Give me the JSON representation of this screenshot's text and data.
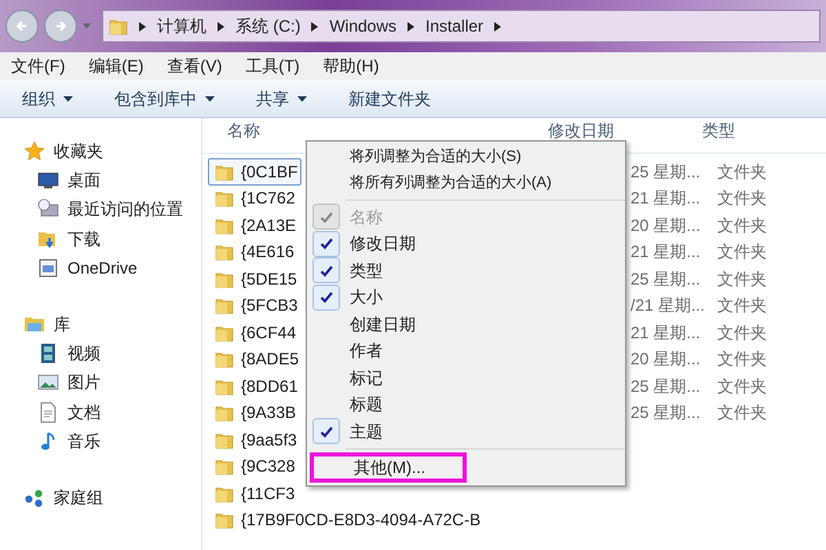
{
  "address": {
    "crumbs": [
      "计算机",
      "系统 (C:)",
      "Windows",
      "Installer"
    ]
  },
  "menu_bar": [
    "文件(F)",
    "编辑(E)",
    "查看(V)",
    "工具(T)",
    "帮助(H)"
  ],
  "toolbar": [
    {
      "label": "组织",
      "dropdown": true
    },
    {
      "label": "包含到库中",
      "dropdown": true
    },
    {
      "label": "共享",
      "dropdown": true
    },
    {
      "label": "新建文件夹",
      "dropdown": false
    }
  ],
  "sidebar": {
    "groups": [
      {
        "label": "收藏夹",
        "kind": "favorites",
        "children": [
          {
            "label": "桌面",
            "kind": "desktop"
          },
          {
            "label": "最近访问的位置",
            "kind": "recent"
          },
          {
            "label": "下载",
            "kind": "downloads"
          },
          {
            "label": "OneDrive",
            "kind": "onedrive"
          }
        ]
      },
      {
        "label": "库",
        "kind": "libraries",
        "children": [
          {
            "label": "视频",
            "kind": "video"
          },
          {
            "label": "图片",
            "kind": "pictures"
          },
          {
            "label": "文档",
            "kind": "documents"
          },
          {
            "label": "音乐",
            "kind": "music"
          }
        ]
      },
      {
        "label": "家庭组",
        "kind": "homegroup"
      }
    ]
  },
  "table": {
    "columns": [
      "名称",
      "修改日期",
      "类型"
    ],
    "rows": [
      {
        "name": "{0C1BF",
        "date": "25 星期...",
        "type": "文件夹",
        "selected": true
      },
      {
        "name": "{1C762",
        "date": "21 星期...",
        "type": "文件夹",
        "selected": false
      },
      {
        "name": "{2A13E",
        "date": "20 星期...",
        "type": "文件夹",
        "selected": false
      },
      {
        "name": "{4E616",
        "date": "21 星期...",
        "type": "文件夹",
        "selected": false
      },
      {
        "name": "{5DE15",
        "date": "25 星期...",
        "type": "文件夹",
        "selected": false
      },
      {
        "name": "{5FCB3",
        "date": "/21 星期...",
        "type": "文件夹",
        "selected": false
      },
      {
        "name": "{6CF44",
        "date": "21 星期...",
        "type": "文件夹",
        "selected": false
      },
      {
        "name": "{8ADE5",
        "date": "20 星期...",
        "type": "文件夹",
        "selected": false
      },
      {
        "name": "{8DD61",
        "date": "25 星期...",
        "type": "文件夹",
        "selected": false
      },
      {
        "name": "{9A33B",
        "date": "25 星期...",
        "type": "文件夹",
        "selected": false
      },
      {
        "name": "{9aa5f3",
        "selected": false
      },
      {
        "name": "{9C328",
        "selected": false
      },
      {
        "name": "{11CF3",
        "selected": false
      },
      {
        "name": "{17B9F0CD-E8D3-4094-A72C-B",
        "selected": false
      }
    ]
  },
  "context_menu": {
    "actions": [
      "将列调整为合适的大小(S)",
      "将所有列调整为合适的大小(A)"
    ],
    "columns": [
      {
        "label": "名称",
        "checked": true,
        "disabled": true
      },
      {
        "label": "修改日期",
        "checked": true,
        "disabled": false
      },
      {
        "label": "类型",
        "checked": true,
        "disabled": false
      },
      {
        "label": "大小",
        "checked": true,
        "disabled": false
      },
      {
        "label": "创建日期",
        "checked": false,
        "disabled": false
      },
      {
        "label": "作者",
        "checked": false,
        "disabled": false
      },
      {
        "label": "标记",
        "checked": false,
        "disabled": false
      },
      {
        "label": "标题",
        "checked": false,
        "disabled": false
      },
      {
        "label": "主题",
        "checked": true,
        "disabled": false
      }
    ],
    "more": {
      "label": "其他(M)...",
      "highlighted": true
    }
  }
}
